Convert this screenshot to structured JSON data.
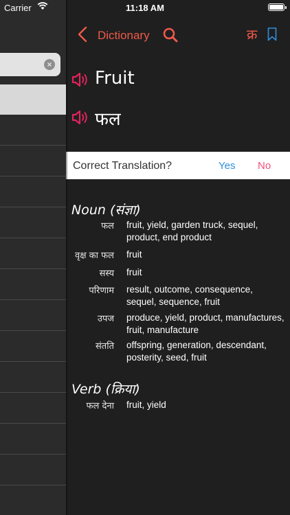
{
  "status_bar": {
    "carrier": "Carrier",
    "time": "11:18 AM"
  },
  "navbar": {
    "title": "Dictionary",
    "lang_glyph": "क्र"
  },
  "word": {
    "english": "Fruit",
    "hindi": "फल"
  },
  "feedback": {
    "question": "Correct Translation?",
    "yes": "Yes",
    "no": "No"
  },
  "noun": {
    "heading": "Noun (संज्ञा)",
    "entries": [
      {
        "hindi": "फल",
        "english": "fruit, yield, garden truck, sequel, product, end product"
      },
      {
        "hindi": "वृक्ष का फल",
        "english": "fruit"
      },
      {
        "hindi": "सस्य",
        "english": "fruit"
      },
      {
        "hindi": "परिणाम",
        "english": "result, outcome, consequence, sequel, sequence, fruit"
      },
      {
        "hindi": "उपज",
        "english": "produce, yield, product, manufactures, fruit, manufacture"
      },
      {
        "hindi": "संतति",
        "english": "offspring, generation, descendant, posterity, seed, fruit"
      }
    ]
  },
  "verb": {
    "heading": "Verb (क्रिया)",
    "entries": [
      {
        "hindi": "फल देना",
        "english": "fruit, yield"
      }
    ]
  },
  "colors": {
    "accent": "#ef5a4a",
    "yes": "#2f8fdc",
    "no": "#ef4f7a",
    "background": "#1f1f1f"
  }
}
